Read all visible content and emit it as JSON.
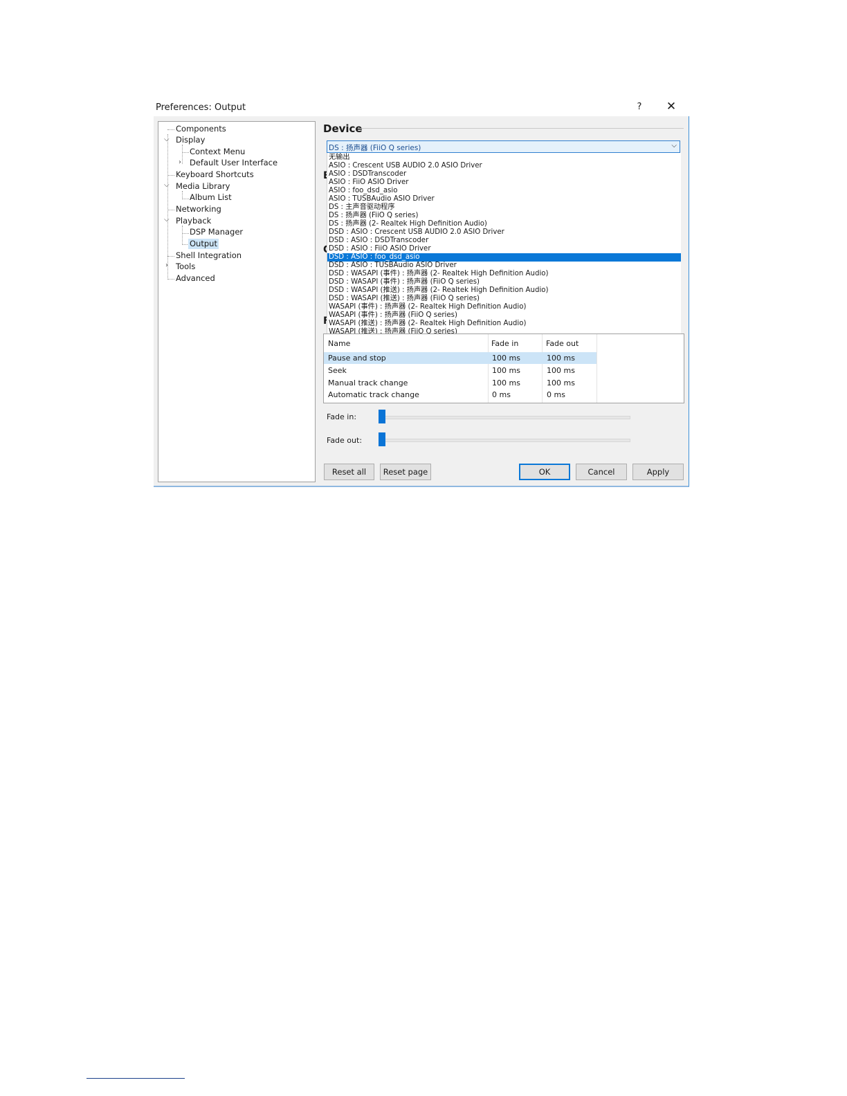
{
  "window": {
    "title": "Preferences: Output",
    "help": "?",
    "close": "✕"
  },
  "tree": [
    "Components",
    "Display",
    "Context Menu",
    "Default User Interface",
    "Keyboard Shortcuts",
    "Media Library",
    "Album List",
    "Networking",
    "Playback",
    "DSP Manager",
    "Output",
    "Shell Integration",
    "Tools",
    "Advanced"
  ],
  "device": {
    "group_title": "Device",
    "selected": "DS : 扬声器 (FiiO Q series)",
    "options": [
      "无输出",
      "ASIO : Crescent USB AUDIO 2.0 ASIO Driver",
      "ASIO : DSDTranscoder",
      "ASIO : FiiO ASIO Driver",
      "ASIO : foo_dsd_asio",
      "ASIO : TUSBAudio ASIO Driver",
      "DS : 主声音驱动程序",
      "DS : 扬声器 (FiiO Q series)",
      "DS : 扬声器 (2- Realtek High Definition Audio)",
      "DSD : ASIO : Crescent USB AUDIO 2.0 ASIO Driver",
      "DSD : ASIO : DSDTranscoder",
      "DSD : ASIO : FiiO ASIO Driver",
      "DSD : ASIO : foo_dsd_asio",
      "DSD : ASIO : TUSBAudio ASIO Driver",
      "DSD : WASAPI (事件) : 扬声器 (2- Realtek High Definition Audio)",
      "DSD : WASAPI (事件) : 扬声器 (FiiO Q series)",
      "DSD : WASAPI (推送) : 扬声器 (2- Realtek High Definition Audio)",
      "DSD : WASAPI (推送) : 扬声器 (FiiO Q series)",
      "WASAPI (事件) : 扬声器 (2- Realtek High Definition Audio)",
      "WASAPI (事件) : 扬声器 (FiiO Q series)",
      "WASAPI (推送) : 扬声器 (2- Realtek High Definition Audio)",
      "WASAPI (推送) : 扬声器 (FiiO Q series)"
    ],
    "highlighted_index": 12,
    "obscured_letters": [
      "E",
      "C",
      "F"
    ]
  },
  "fading": {
    "columns": [
      "Name",
      "Fade in",
      "Fade out"
    ],
    "rows": [
      [
        "Pause and stop",
        "100 ms",
        "100 ms"
      ],
      [
        "Seek",
        "100 ms",
        "100 ms"
      ],
      [
        "Manual track change",
        "100 ms",
        "100 ms"
      ],
      [
        "Automatic track change",
        "0 ms",
        "0 ms"
      ]
    ],
    "fade_in_label": "Fade in:",
    "fade_out_label": "Fade out:",
    "fade_in_level": 0,
    "fade_out_level": 0
  },
  "buttons": {
    "reset_all": "Reset all",
    "reset_page": "Reset page",
    "ok": "OK",
    "cancel": "Cancel",
    "apply": "Apply"
  },
  "colors": {
    "accent": "#0a78d7",
    "selection": "#cce4f7"
  }
}
